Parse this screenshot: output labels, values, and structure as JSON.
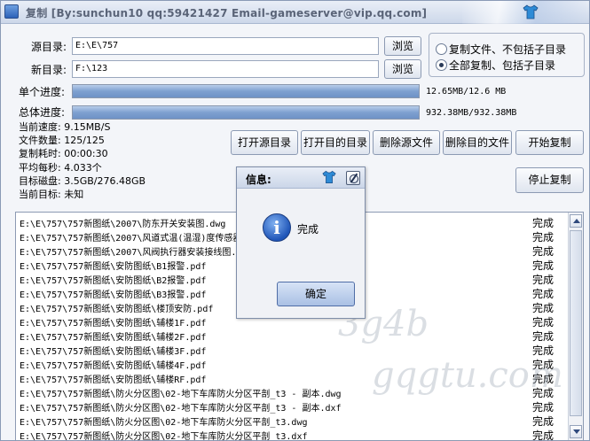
{
  "window": {
    "title": "复制 [By:sunchun10 qq:59421427 Email-gameserver@vip.qq.com]"
  },
  "form": {
    "source_label": "源目录:",
    "source_value": "E:\\E\\757",
    "target_label": "新目录:",
    "target_value": "F:\\123",
    "browse_label": "浏览"
  },
  "options": {
    "opt1": "复制文件、不包括子目录",
    "opt2": "全部复制、包括子目录",
    "selected": "opt2"
  },
  "progress": {
    "single_label": "单个进度:",
    "single_text": "12.65MB/12.6 MB",
    "single_fraction": 1.0,
    "total_label": "总体进度:",
    "total_text": "932.38MB/932.38MB",
    "total_fraction": 1.0
  },
  "stats": {
    "speed": "当前速度: 9.15MB/S",
    "count": "文件数量: 125/125",
    "elapsed": "复制耗时: 00:00:30",
    "avg": "平均每秒: 4.033个",
    "disk": "目标磁盘: 3.5GB/276.48GB",
    "current": "当前目标: 未知"
  },
  "buttons": {
    "open_source": "打开源目录",
    "open_target": "打开目的目录",
    "delete_source": "删除源文件",
    "delete_target": "删除目的文件",
    "start": "开始复制",
    "stop": "停止复制"
  },
  "list": {
    "rows": [
      {
        "path": "E:\\E\\757\\757新图纸\\2007\\防东开关安装图.dwg",
        "status": "完成"
      },
      {
        "path": "E:\\E\\757\\757新图纸\\2007\\风道式温(温湿)度传感器安装图.dwg",
        "status": "完成"
      },
      {
        "path": "E:\\E\\757\\757新图纸\\2007\\风阀执行器安装接线图.dwg",
        "status": "完成"
      },
      {
        "path": "E:\\E\\757\\757新图纸\\安防图纸\\B1报警.pdf",
        "status": "完成"
      },
      {
        "path": "E:\\E\\757\\757新图纸\\安防图纸\\B2报警.pdf",
        "status": "完成"
      },
      {
        "path": "E:\\E\\757\\757新图纸\\安防图纸\\B3报警.pdf",
        "status": "完成"
      },
      {
        "path": "E:\\E\\757\\757新图纸\\安防图纸\\楼顶安防.pdf",
        "status": "完成"
      },
      {
        "path": "E:\\E\\757\\757新图纸\\安防图纸\\辅楼1F.pdf",
        "status": "完成"
      },
      {
        "path": "E:\\E\\757\\757新图纸\\安防图纸\\辅楼2F.pdf",
        "status": "完成"
      },
      {
        "path": "E:\\E\\757\\757新图纸\\安防图纸\\辅楼3F.pdf",
        "status": "完成"
      },
      {
        "path": "E:\\E\\757\\757新图纸\\安防图纸\\辅楼4F.pdf",
        "status": "完成"
      },
      {
        "path": "E:\\E\\757\\757新图纸\\安防图纸\\辅楼RF.pdf",
        "status": "完成"
      },
      {
        "path": "E:\\E\\757\\757新图纸\\防火分区图\\02-地下车库防火分区平剖_t3 - 副本.dwg",
        "status": "完成"
      },
      {
        "path": "E:\\E\\757\\757新图纸\\防火分区图\\02-地下车库防火分区平剖_t3 - 副本.dxf",
        "status": "完成"
      },
      {
        "path": "E:\\E\\757\\757新图纸\\防火分区图\\02-地下车库防火分区平剖_t3.dwg",
        "status": "完成"
      },
      {
        "path": "E:\\E\\757\\757新图纸\\防火分区图\\02-地下车库防火分区平剖_t3.dxf",
        "status": "完成"
      }
    ]
  },
  "dialog": {
    "title": "信息:",
    "message": "完成",
    "ok_label": "确定",
    "icon": "info-icon"
  },
  "watermark": {
    "text1": "3g4b",
    "text2": "gqgtu.com"
  },
  "colors": {
    "progress_fill": "#7ea0d0",
    "accent": "#4f6da6"
  }
}
